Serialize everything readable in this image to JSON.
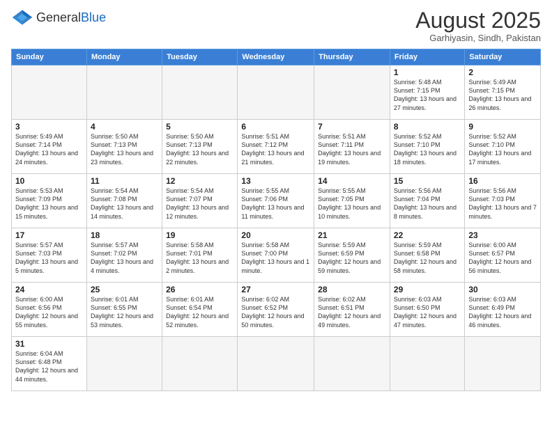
{
  "logo": {
    "text_general": "General",
    "text_blue": "Blue"
  },
  "header": {
    "month_title": "August 2025",
    "subtitle": "Garhiyasin, Sindh, Pakistan"
  },
  "weekdays": [
    "Sunday",
    "Monday",
    "Tuesday",
    "Wednesday",
    "Thursday",
    "Friday",
    "Saturday"
  ],
  "weeks": [
    [
      {
        "day": "",
        "info": ""
      },
      {
        "day": "",
        "info": ""
      },
      {
        "day": "",
        "info": ""
      },
      {
        "day": "",
        "info": ""
      },
      {
        "day": "",
        "info": ""
      },
      {
        "day": "1",
        "info": "Sunrise: 5:48 AM\nSunset: 7:15 PM\nDaylight: 13 hours and 27 minutes."
      },
      {
        "day": "2",
        "info": "Sunrise: 5:49 AM\nSunset: 7:15 PM\nDaylight: 13 hours and 26 minutes."
      }
    ],
    [
      {
        "day": "3",
        "info": "Sunrise: 5:49 AM\nSunset: 7:14 PM\nDaylight: 13 hours and 24 minutes."
      },
      {
        "day": "4",
        "info": "Sunrise: 5:50 AM\nSunset: 7:13 PM\nDaylight: 13 hours and 23 minutes."
      },
      {
        "day": "5",
        "info": "Sunrise: 5:50 AM\nSunset: 7:13 PM\nDaylight: 13 hours and 22 minutes."
      },
      {
        "day": "6",
        "info": "Sunrise: 5:51 AM\nSunset: 7:12 PM\nDaylight: 13 hours and 21 minutes."
      },
      {
        "day": "7",
        "info": "Sunrise: 5:51 AM\nSunset: 7:11 PM\nDaylight: 13 hours and 19 minutes."
      },
      {
        "day": "8",
        "info": "Sunrise: 5:52 AM\nSunset: 7:10 PM\nDaylight: 13 hours and 18 minutes."
      },
      {
        "day": "9",
        "info": "Sunrise: 5:52 AM\nSunset: 7:10 PM\nDaylight: 13 hours and 17 minutes."
      }
    ],
    [
      {
        "day": "10",
        "info": "Sunrise: 5:53 AM\nSunset: 7:09 PM\nDaylight: 13 hours and 15 minutes."
      },
      {
        "day": "11",
        "info": "Sunrise: 5:54 AM\nSunset: 7:08 PM\nDaylight: 13 hours and 14 minutes."
      },
      {
        "day": "12",
        "info": "Sunrise: 5:54 AM\nSunset: 7:07 PM\nDaylight: 13 hours and 12 minutes."
      },
      {
        "day": "13",
        "info": "Sunrise: 5:55 AM\nSunset: 7:06 PM\nDaylight: 13 hours and 11 minutes."
      },
      {
        "day": "14",
        "info": "Sunrise: 5:55 AM\nSunset: 7:05 PM\nDaylight: 13 hours and 10 minutes."
      },
      {
        "day": "15",
        "info": "Sunrise: 5:56 AM\nSunset: 7:04 PM\nDaylight: 13 hours and 8 minutes."
      },
      {
        "day": "16",
        "info": "Sunrise: 5:56 AM\nSunset: 7:03 PM\nDaylight: 13 hours and 7 minutes."
      }
    ],
    [
      {
        "day": "17",
        "info": "Sunrise: 5:57 AM\nSunset: 7:03 PM\nDaylight: 13 hours and 5 minutes."
      },
      {
        "day": "18",
        "info": "Sunrise: 5:57 AM\nSunset: 7:02 PM\nDaylight: 13 hours and 4 minutes."
      },
      {
        "day": "19",
        "info": "Sunrise: 5:58 AM\nSunset: 7:01 PM\nDaylight: 13 hours and 2 minutes."
      },
      {
        "day": "20",
        "info": "Sunrise: 5:58 AM\nSunset: 7:00 PM\nDaylight: 13 hours and 1 minute."
      },
      {
        "day": "21",
        "info": "Sunrise: 5:59 AM\nSunset: 6:59 PM\nDaylight: 12 hours and 59 minutes."
      },
      {
        "day": "22",
        "info": "Sunrise: 5:59 AM\nSunset: 6:58 PM\nDaylight: 12 hours and 58 minutes."
      },
      {
        "day": "23",
        "info": "Sunrise: 6:00 AM\nSunset: 6:57 PM\nDaylight: 12 hours and 56 minutes."
      }
    ],
    [
      {
        "day": "24",
        "info": "Sunrise: 6:00 AM\nSunset: 6:56 PM\nDaylight: 12 hours and 55 minutes."
      },
      {
        "day": "25",
        "info": "Sunrise: 6:01 AM\nSunset: 6:55 PM\nDaylight: 12 hours and 53 minutes."
      },
      {
        "day": "26",
        "info": "Sunrise: 6:01 AM\nSunset: 6:54 PM\nDaylight: 12 hours and 52 minutes."
      },
      {
        "day": "27",
        "info": "Sunrise: 6:02 AM\nSunset: 6:52 PM\nDaylight: 12 hours and 50 minutes."
      },
      {
        "day": "28",
        "info": "Sunrise: 6:02 AM\nSunset: 6:51 PM\nDaylight: 12 hours and 49 minutes."
      },
      {
        "day": "29",
        "info": "Sunrise: 6:03 AM\nSunset: 6:50 PM\nDaylight: 12 hours and 47 minutes."
      },
      {
        "day": "30",
        "info": "Sunrise: 6:03 AM\nSunset: 6:49 PM\nDaylight: 12 hours and 46 minutes."
      }
    ],
    [
      {
        "day": "31",
        "info": "Sunrise: 6:04 AM\nSunset: 6:48 PM\nDaylight: 12 hours and 44 minutes."
      },
      {
        "day": "",
        "info": ""
      },
      {
        "day": "",
        "info": ""
      },
      {
        "day": "",
        "info": ""
      },
      {
        "day": "",
        "info": ""
      },
      {
        "day": "",
        "info": ""
      },
      {
        "day": "",
        "info": ""
      }
    ]
  ]
}
